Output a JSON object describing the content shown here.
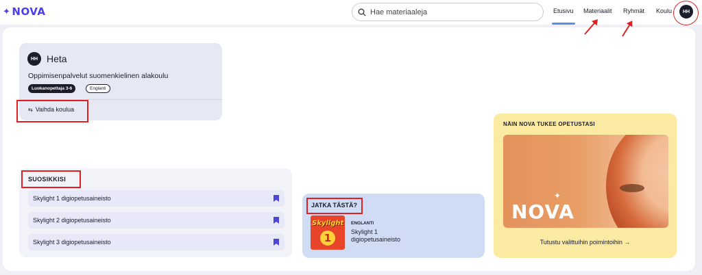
{
  "header": {
    "logo": "NOVA",
    "search_placeholder": "Hae materiaaleja",
    "nav": [
      {
        "label": "Etusivu",
        "active": true
      },
      {
        "label": "Materiaalit",
        "active": false
      },
      {
        "label": "Ryhmät",
        "active": false
      },
      {
        "label": "Koulu",
        "active": false
      }
    ],
    "avatar_initials": "HH"
  },
  "profile": {
    "initials": "HH",
    "name": "Heta",
    "school": "Oppimisenpalvelut suomenkielinen alakoulu",
    "chips": [
      "Luokanopettaja 3-6",
      "Englanti"
    ],
    "switch_label": "Vaihda koulua"
  },
  "favorites": {
    "title": "SUOSIKKISI",
    "items": [
      "Skylight 1 digiopetusaineisto",
      "Skylight 2 digiopetusaineisto",
      "Skylight 3 digiopetusaineisto"
    ]
  },
  "continue": {
    "title": "JATKA TÄSTÄ?",
    "subject": "ENGLANTI",
    "material": "Skylight 1 digiopetusaineisto",
    "thumb_text": "Skylight",
    "thumb_number": "1"
  },
  "promo": {
    "title": "NÄIN NOVA TUKEE OPETUSTASI",
    "image_brand": "NOVA",
    "link": "Tutustu valittuihin poimintoihin →"
  },
  "colors": {
    "brand": "#4b3df0",
    "annotation": "#e02020",
    "promo_bg": "#fbeaa1",
    "continue_bg": "#cfdcf4"
  }
}
